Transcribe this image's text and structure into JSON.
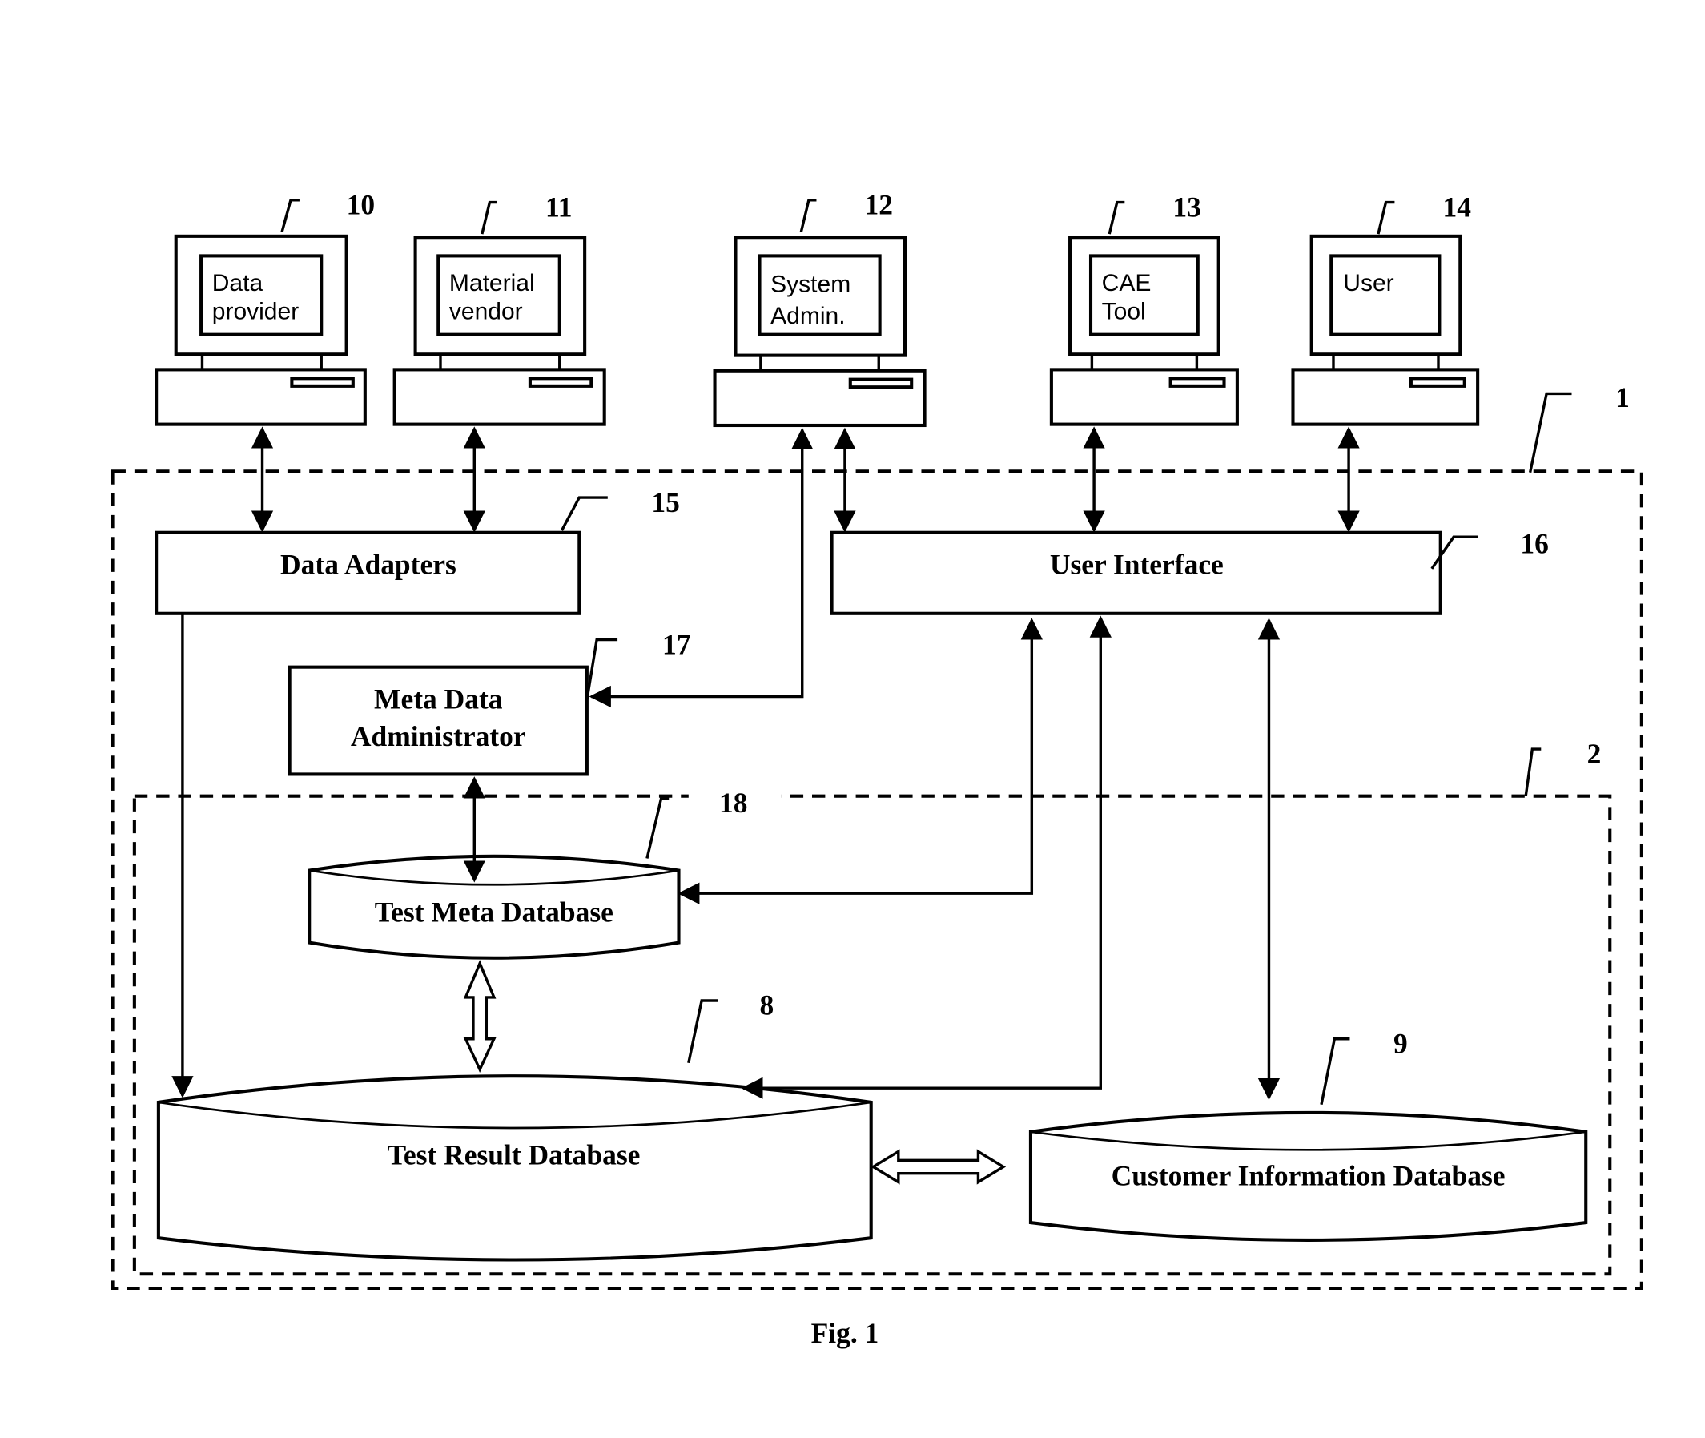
{
  "figure": {
    "caption": "Fig. 1",
    "colors": {
      "ink": "#000000",
      "background": "#ffffff"
    }
  },
  "terminals": [
    {
      "ref": "10",
      "line1": "Data",
      "line2": "provider"
    },
    {
      "ref": "11",
      "line1": "Material",
      "line2": "vendor"
    },
    {
      "ref": "12",
      "line1": "System",
      "line2": "Admin."
    },
    {
      "ref": "13",
      "line1": "CAE",
      "line2": "Tool"
    },
    {
      "ref": "14",
      "line1": "User",
      "line2": ""
    }
  ],
  "system": {
    "ref": "1"
  },
  "database_layer": {
    "ref": "2"
  },
  "components": {
    "data_adapters": {
      "ref": "15",
      "label": "Data Adapters"
    },
    "user_interface": {
      "ref": "16",
      "label": "User Interface"
    },
    "meta_data_admin": {
      "ref": "17",
      "line1": "Meta Data",
      "line2": "Administrator"
    },
    "test_meta_db": {
      "ref": "18",
      "label": "Test Meta Database"
    },
    "test_result_db": {
      "ref": "8",
      "label": "Test Result Database"
    },
    "customer_info_db": {
      "ref": "9",
      "label": "Customer Information Database"
    }
  }
}
